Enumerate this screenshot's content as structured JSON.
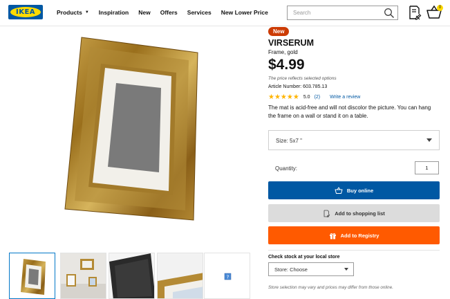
{
  "header": {
    "logo_text": "IKEA",
    "nav": [
      "Products",
      "Inspiration",
      "New",
      "Offers",
      "Services",
      "New Lower Price"
    ],
    "search_placeholder": "Search",
    "cart_count": "0"
  },
  "product": {
    "badge": "New",
    "name": "VIRSERUM",
    "description": "Frame, gold",
    "price": "$4.99",
    "price_note": "The price reflects selected options",
    "article_number": "Article Number: 603.785.13",
    "stars": "★★★★★",
    "rating_value": "5.0",
    "rating_count": "(2)",
    "write_review": "Write a review",
    "details": "The mat is acid-free and will not discolor the picture. You can hang the frame on a wall or stand it on a table.",
    "size_label": "Size: 5x7 \"",
    "quantity_label": "Quantity:",
    "quantity_value": "1",
    "buy_online": "Buy online",
    "add_to_list": "Add to shopping list",
    "add_to_registry": "Add to Registry",
    "stock_title": "Check stock at your local store",
    "store_label": "Store: Choose",
    "store_note": "Store selection may vary and prices may differ from those online."
  },
  "colors": {
    "ikea_blue": "#0058a3",
    "ikea_yellow": "#ffdb00",
    "new_badge": "#cc3b04",
    "registry_orange": "#ff5a00",
    "star": "#ffb400"
  }
}
